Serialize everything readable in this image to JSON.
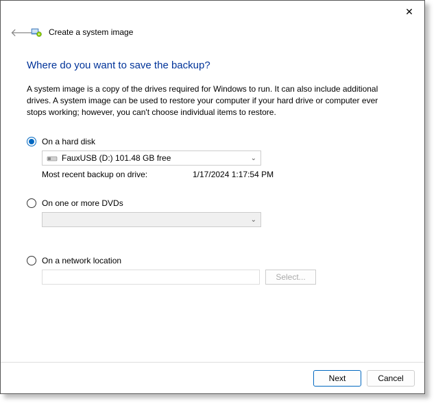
{
  "window": {
    "title": "Create a system image"
  },
  "heading": "Where do you want to save the backup?",
  "description": "A system image is a copy of the drives required for Windows to run. It can also include additional drives. A system image can be used to restore your computer if your hard drive or computer ever stops working; however, you can't choose individual items to restore.",
  "options": {
    "hard_disk": {
      "label": "On a hard disk",
      "selected_drive": "FauxUSB (D:)  101.48 GB free",
      "recent_backup_label": "Most recent backup on drive:",
      "recent_backup_value": "1/17/2024 1:17:54 PM"
    },
    "dvd": {
      "label": "On one or more DVDs"
    },
    "network": {
      "label": "On a network location",
      "select_button": "Select..."
    }
  },
  "footer": {
    "next": "Next",
    "cancel": "Cancel"
  }
}
